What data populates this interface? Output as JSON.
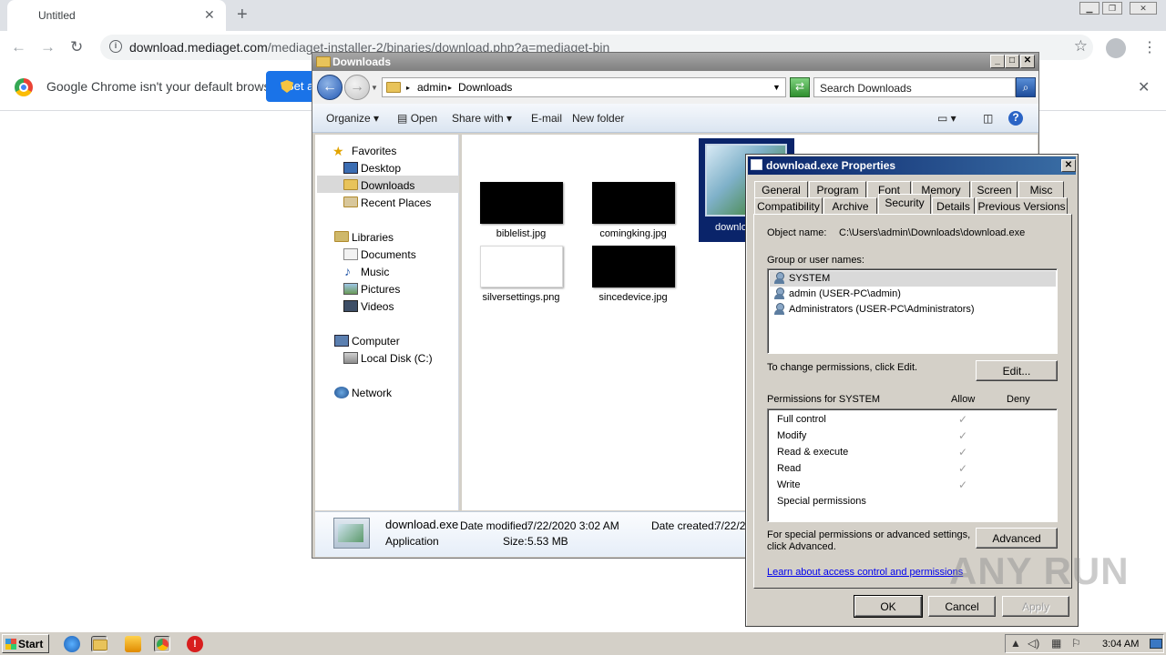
{
  "chrome": {
    "tab_title": "Untitled",
    "url_domain": "download.mediaget.com",
    "url_path": "/mediaget-installer-2/binaries/download.php?a=mediaget-bin",
    "infobar_text": "Google Chrome isn't your default browser",
    "infobar_button_label": "Set as default"
  },
  "explorer": {
    "title": "Downloads",
    "breadcrumb": [
      "admin",
      "Downloads"
    ],
    "search_placeholder": "Search Downloads",
    "commands": {
      "organize": "Organize",
      "open": "Open",
      "share_with": "Share with",
      "email": "E-mail",
      "new_folder": "New folder"
    },
    "nav": {
      "favorites": "Favorites",
      "desktop": "Desktop",
      "downloads": "Downloads",
      "recent_places": "Recent Places",
      "libraries": "Libraries",
      "documents": "Documents",
      "music": "Music",
      "pictures": "Pictures",
      "videos": "Videos",
      "computer": "Computer",
      "local_disk": "Local Disk (C:)",
      "network": "Network"
    },
    "files": [
      {
        "name": "biblelist.jpg"
      },
      {
        "name": "comingking.jpg"
      },
      {
        "name": "silversettings.png"
      },
      {
        "name": "sincedevice.jpg"
      },
      {
        "name": "downlo"
      }
    ],
    "details": {
      "filename": "download.exe",
      "type": "Application",
      "date_modified_label": "Date modified:",
      "date_modified": "7/22/2020 3:02 AM",
      "size_label": "Size:",
      "size": "5.53 MB",
      "date_created_label": "Date created:",
      "date_created": "7/22/2"
    }
  },
  "props": {
    "title": "download.exe Properties",
    "tabs_row1": [
      "General",
      "Program",
      "Font",
      "Memory",
      "Screen",
      "Misc"
    ],
    "tabs_row2": [
      "Compatibility",
      "Archive",
      "Security",
      "Details",
      "Previous Versions"
    ],
    "object_name_label": "Object name:",
    "object_name": "C:\\Users\\admin\\Downloads\\download.exe",
    "group_label": "Group or user names:",
    "users": [
      "SYSTEM",
      "admin (USER-PC\\admin)",
      "Administrators (USER-PC\\Administrators)"
    ],
    "change_perm_text": "To change permissions, click Edit.",
    "edit_button": "Edit...",
    "perm_for": "Permissions for SYSTEM",
    "allow": "Allow",
    "deny": "Deny",
    "permissions": [
      "Full control",
      "Modify",
      "Read & execute",
      "Read",
      "Write",
      "Special permissions"
    ],
    "special_text_1": "For special permissions or advanced settings,",
    "special_text_2": "click Advanced.",
    "advanced_button": "Advanced",
    "learn_link": "Learn about access control and permissions",
    "ok": "OK",
    "cancel": "Cancel",
    "apply": "Apply"
  },
  "taskbar": {
    "start": "Start",
    "clock": "3:04 AM"
  },
  "watermark": "ANY RUN"
}
